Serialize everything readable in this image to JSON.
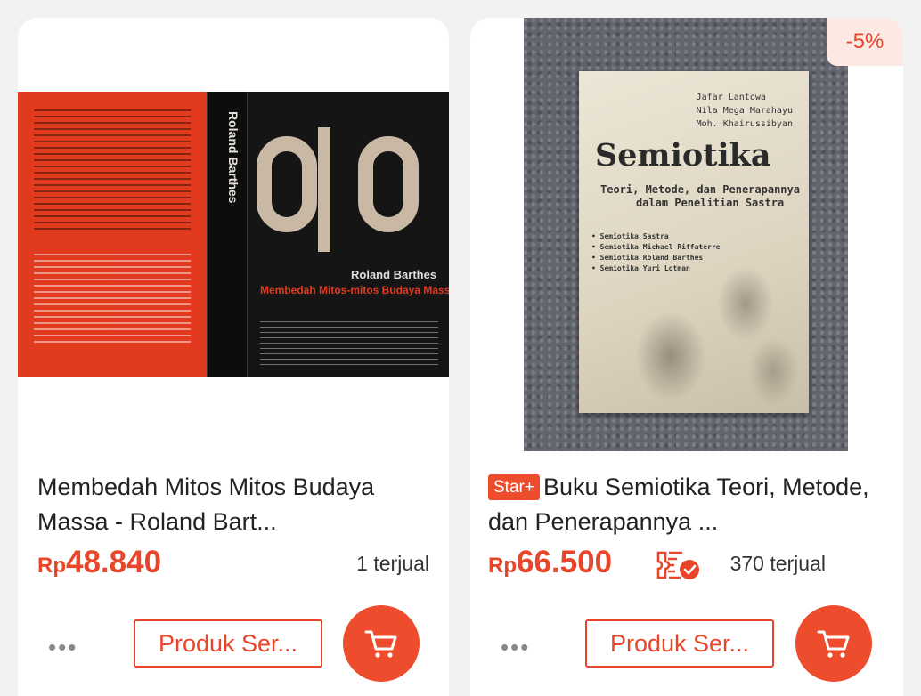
{
  "products": [
    {
      "title": "Membedah Mitos Mitos Budaya Massa - Roland Bart...",
      "currency": "Rp",
      "price": "48.840",
      "sold": "1 terjual",
      "similar_label": "Produk Ser...",
      "cover": {
        "spine_author": "Roland Barthes",
        "front_author": "Roland Barthes",
        "front_title": "Membedah Mitos-mitos Budaya Massa"
      }
    },
    {
      "badge": "Star+",
      "title": "Buku Semiotika Teori, Metode, dan Penerapannya ...",
      "discount": "-5%",
      "currency": "Rp",
      "price": "66.500",
      "sold": "370 terjual",
      "similar_label": "Produk Ser...",
      "cover": {
        "authors": [
          "Jafar Lantowa",
          "Nila Mega Marahayu",
          "Moh. Khairussibyan"
        ],
        "title": "Semiotika",
        "subtitle_1": "Teori, Metode, dan Penerapannya",
        "subtitle_2": "dalam Penelitian Sastra",
        "bullets": [
          "Semiotika Sastra",
          "Semiotika Michael Riffaterre",
          "Semiotika Roland Barthes",
          "Semiotika Yuri Lotman"
        ]
      }
    }
  ],
  "colors": {
    "accent": "#ee4d2d",
    "price": "#e8462a",
    "background": "#f2f2f2"
  },
  "icons": {
    "more": "more-dots-icon",
    "cart": "cart-icon",
    "shipping": "shipping-verified-icon"
  }
}
